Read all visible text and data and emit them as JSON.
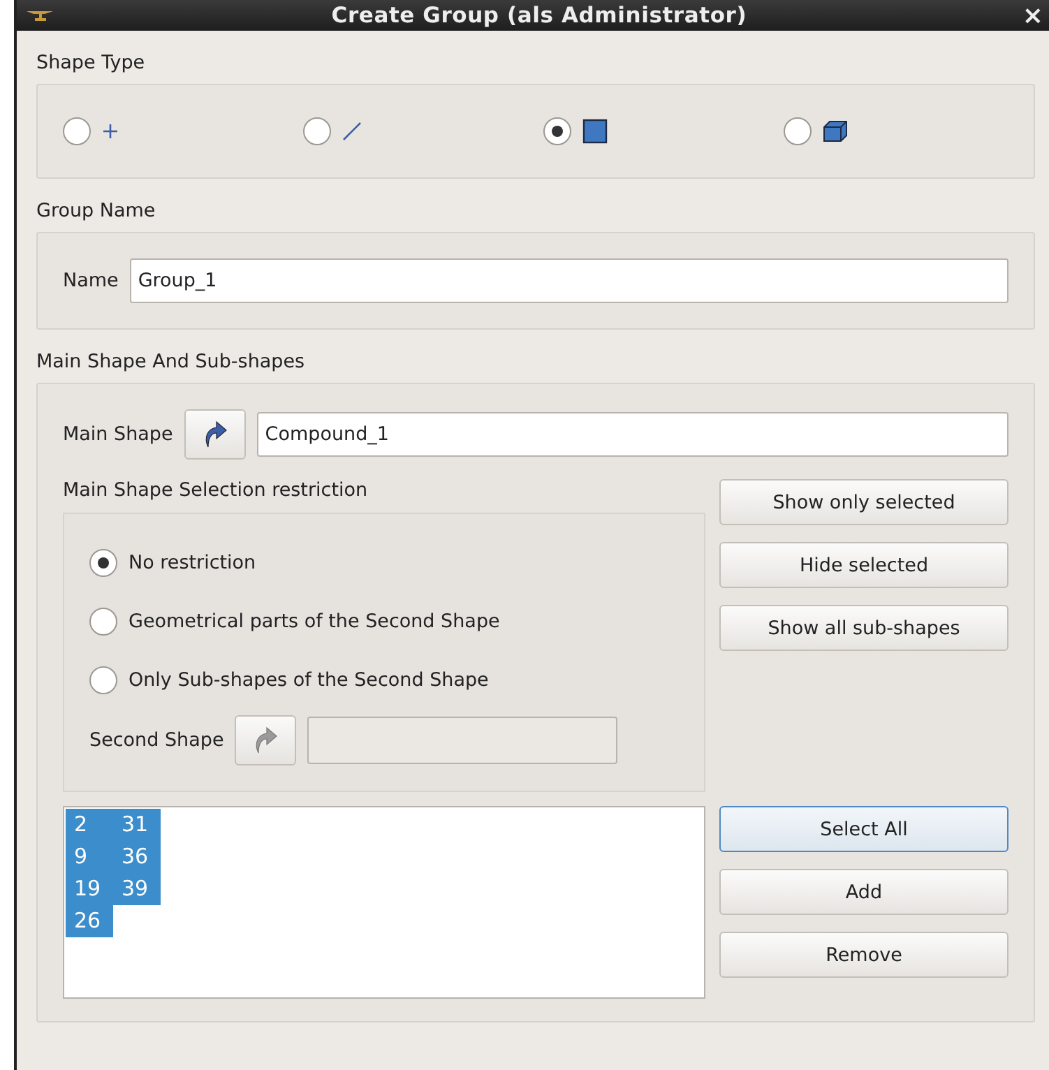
{
  "window": {
    "title": "Create Group (als Administrator)",
    "close": "×"
  },
  "shape_type": {
    "label": "Shape Type",
    "options": [
      {
        "kind": "point",
        "selected": false
      },
      {
        "kind": "edge",
        "selected": false
      },
      {
        "kind": "face",
        "selected": true
      },
      {
        "kind": "solid",
        "selected": false
      }
    ]
  },
  "group_name": {
    "label": "Group Name",
    "name_label": "Name",
    "value": "Group_1"
  },
  "main": {
    "label": "Main Shape And Sub-shapes",
    "main_shape_label": "Main Shape",
    "main_shape_value": "Compound_1",
    "restriction_label": "Main Shape Selection restriction",
    "restrictions": [
      {
        "label": "No restriction",
        "selected": true
      },
      {
        "label": "Geometrical parts of the Second Shape",
        "selected": false
      },
      {
        "label": "Only Sub-shapes of the Second Shape",
        "selected": false
      }
    ],
    "second_shape_label": "Second Shape",
    "side_buttons": [
      "Show only selected",
      "Hide selected",
      "Show all sub-shapes"
    ],
    "ids": [
      {
        "text": "2",
        "selected": true
      },
      {
        "text": "9",
        "selected": true
      },
      {
        "text": "19",
        "selected": true
      },
      {
        "text": "26",
        "selected": true
      },
      {
        "text": "31",
        "selected": true
      },
      {
        "text": "36",
        "selected": true
      },
      {
        "text": "39",
        "selected": true
      }
    ],
    "list_buttons": [
      {
        "label": "Select All",
        "focused": true
      },
      {
        "label": "Add",
        "focused": false
      },
      {
        "label": "Remove",
        "focused": false
      }
    ]
  }
}
